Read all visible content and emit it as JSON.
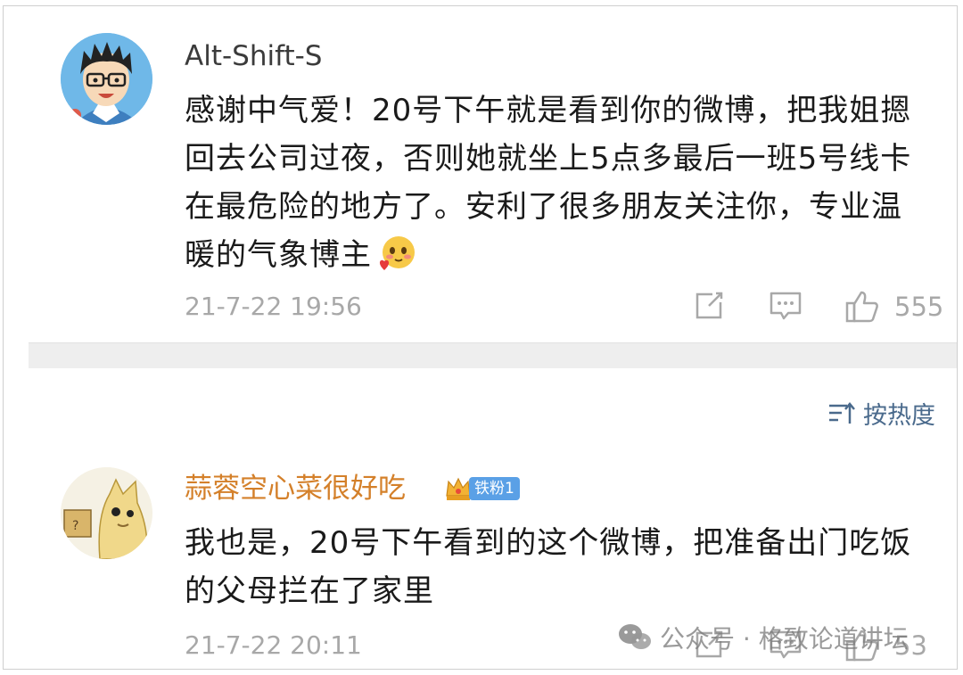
{
  "comments": [
    {
      "username": "Alt-Shift-S",
      "text": "感谢中气爱！20号下午就是看到你的微博，把我姐摁回去公司过夜，否则她就坐上5点多最后一班5号线卡在最危险的地方了。安利了很多朋友关注你，专业温暖的气象博主",
      "emoji": "blush-heart-emoji",
      "timestamp": "21-7-22 19:56",
      "likes": "555",
      "avatar": "cartoon-boy-glasses"
    },
    {
      "username": "蒜蓉空心菜很好吃",
      "badge": "铁粉1",
      "text": "我也是，20号下午看到的这个微博，把准备出门吃饭的父母拦在了家里",
      "timestamp": "21-7-22 20:11",
      "likes": "53",
      "avatar": "cartoon-cat"
    }
  ],
  "sort": {
    "label": "按热度",
    "icon": "sort-icon"
  },
  "watermark": {
    "text": "公众号 · 格致论道讲坛",
    "icon": "wechat-icon"
  },
  "colors": {
    "username_default": "#3b3b3b",
    "username_fan": "#d4802a",
    "meta": "#a8a8a8",
    "sort": "#4a6a8c",
    "badge": "#5aa0e6"
  }
}
